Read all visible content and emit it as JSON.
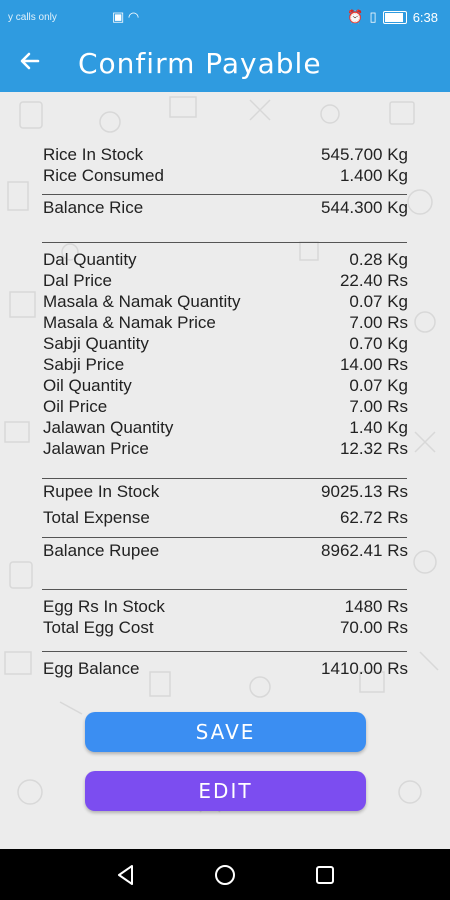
{
  "status_bar": {
    "left_text": "y calls only",
    "time": "6:38"
  },
  "app_bar": {
    "title": "Confirm Payable",
    "back_icon": "arrow-left-icon"
  },
  "summary": {
    "rice_in_stock": {
      "label": "Rice In Stock",
      "value": "545.700 Kg"
    },
    "rice_consumed": {
      "label": "Rice Consumed",
      "value": "1.400 Kg"
    },
    "balance_rice": {
      "label": "Balance Rice",
      "value": "544.300 Kg"
    },
    "dal_quantity": {
      "label": "Dal Quantity",
      "value": "0.28 Kg"
    },
    "dal_price": {
      "label": "Dal Price",
      "value": "22.40 Rs"
    },
    "masala_quantity": {
      "label": "Masala & Namak Quantity",
      "value": "0.07 Kg"
    },
    "masala_price": {
      "label": "Masala & Namak Price",
      "value": "7.00 Rs"
    },
    "sabji_quantity": {
      "label": "Sabji Quantity",
      "value": "0.70 Kg"
    },
    "sabji_price": {
      "label": "Sabji Price",
      "value": "14.00 Rs"
    },
    "oil_quantity": {
      "label": "Oil Quantity",
      "value": "0.07 Kg"
    },
    "oil_price": {
      "label": "Oil Price",
      "value": "7.00 Rs"
    },
    "jalawan_quantity": {
      "label": "Jalawan Quantity",
      "value": "1.40 Kg"
    },
    "jalawan_price": {
      "label": "Jalawan Price",
      "value": "12.32 Rs"
    },
    "rupee_in_stock": {
      "label": "Rupee In Stock",
      "value": "9025.13 Rs"
    },
    "total_expense": {
      "label": "Total Expense",
      "value": "62.72 Rs"
    },
    "balance_rupee": {
      "label": "Balance Rupee",
      "value": "8962.41 Rs"
    },
    "egg_rs_in_stock": {
      "label": "Egg Rs In Stock",
      "value": "1480 Rs"
    },
    "total_egg_cost": {
      "label": "Total Egg Cost",
      "value": "70.00 Rs"
    },
    "egg_balance": {
      "label": "Egg Balance",
      "value": "1410.00 Rs"
    }
  },
  "buttons": {
    "save_label": "SAVE",
    "edit_label": "EDIT"
  },
  "nav": {
    "back_icon": "triangle-back-icon",
    "home_icon": "circle-home-icon",
    "recents_icon": "square-recents-icon"
  },
  "colors": {
    "app_bar": "#2f9be0",
    "save_button": "#3b8ef2",
    "edit_button": "#7c4df0"
  }
}
